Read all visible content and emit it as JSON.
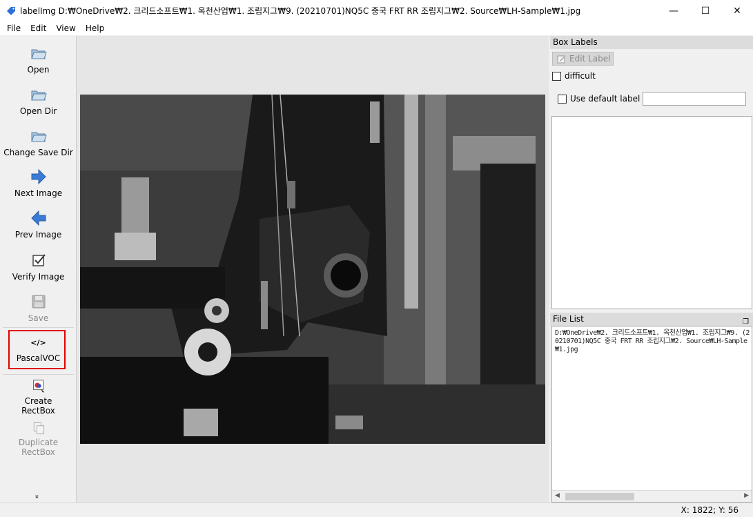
{
  "window": {
    "title": "labelImg D:₩OneDrive₩2. 크리드소프트₩1. 옥천산업₩1. 조립지그₩9. (20210701)NQ5C 중국 FRT RR 조립지그₩2. Source₩LH-Sample₩1.jpg",
    "minimize": "—",
    "maximize": "☐",
    "close": "✕"
  },
  "menu": {
    "file": "File",
    "edit": "Edit",
    "view": "View",
    "help": "Help"
  },
  "toolbar": {
    "open": "Open",
    "open_dir": "Open Dir",
    "change_save_dir": "Change Save Dir",
    "next_image": "Next Image",
    "prev_image": "Prev Image",
    "verify_image": "Verify Image",
    "save": "Save",
    "format_icon": "</>",
    "format": "PascalVOC",
    "create_rectbox_1": "Create",
    "create_rectbox_2": "RectBox",
    "duplicate_rectbox_1": "Duplicate",
    "duplicate_rectbox_2": "RectBox",
    "more": "»"
  },
  "box_labels": {
    "title": "Box Labels",
    "edit_label": "Edit Label",
    "difficult": "difficult",
    "use_default_label": "Use default label",
    "default_label_value": ""
  },
  "file_list": {
    "title": "File List",
    "entry": "D:₩OneDrive₩2. 크리드소프트₩1. 옥천산업₩1. 조립지그₩9. (20210701)NQ5C 중국 FRT RR 조립지그₩2. Source₩LH-Sample₩1.jpg"
  },
  "status": {
    "coords": "X: 1822; Y: 56"
  },
  "colors": {
    "highlight": "#e00000",
    "icon_blue": "#3a7bd5"
  }
}
